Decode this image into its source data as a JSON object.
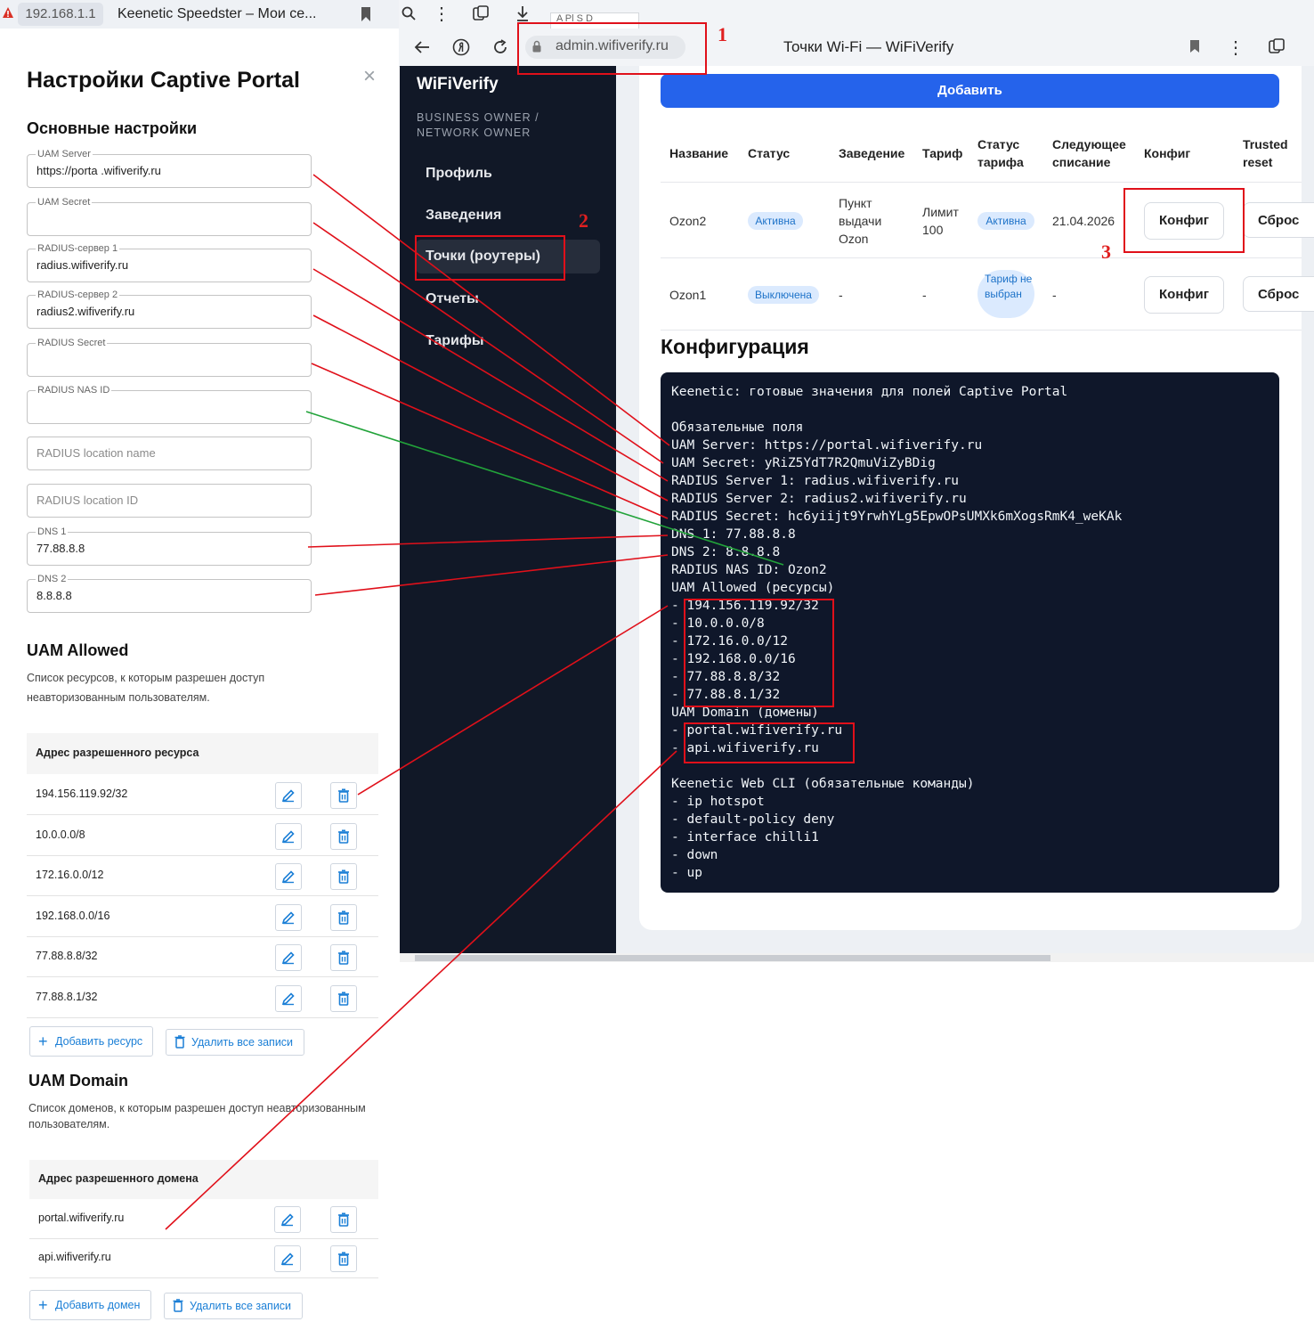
{
  "left_browser": {
    "address": "192.168.1.1",
    "tab_title": "Keenetic Speedster – Мои се..."
  },
  "right_browser": {
    "url": "admin.wifiverify.ru",
    "tab_title": "Точки Wi-Fi — WiFiVerify",
    "tab_strip_text": "A Pl S D"
  },
  "settings": {
    "title": "Настройки Captive Portal",
    "basic_heading": "Основные настройки",
    "fields": [
      {
        "label": "UAM Server",
        "value": "https://porta .wifiverify.ru",
        "placeholder": ""
      },
      {
        "label": "UAM Secret",
        "value": "",
        "placeholder": ""
      },
      {
        "label": "RADIUS-сервер 1",
        "value": "radius.wifiverify.ru",
        "placeholder": ""
      },
      {
        "label": "RADIUS-сервер 2",
        "value": "radius2.wifiverify.ru",
        "placeholder": ""
      },
      {
        "label": "RADIUS Secret",
        "value": "",
        "placeholder": ""
      },
      {
        "label": "RADIUS NAS ID",
        "value": "",
        "placeholder": ""
      },
      {
        "label": "",
        "value": "",
        "placeholder": "RADIUS location name"
      },
      {
        "label": "",
        "value": "",
        "placeholder": "RADIUS location ID"
      },
      {
        "label": "DNS 1",
        "value": "77.88.8.8",
        "placeholder": ""
      },
      {
        "label": "DNS 2",
        "value": "8.8.8.8",
        "placeholder": ""
      }
    ],
    "uam_allowed": {
      "heading": "UAM Allowed",
      "description": "Список ресурсов, к которым разрешен доступ неавторизованным пользователям.",
      "column": "Адрес разрешенного ресурса",
      "rows": [
        "194.156.119.92/32",
        "10.0.0.0/8",
        "172.16.0.0/12",
        "192.168.0.0/16",
        "77.88.8.8/32",
        "77.88.8.1/32"
      ],
      "add_label": "Добавить ресурс",
      "delete_all_label": "Удалить все записи"
    },
    "uam_domain": {
      "heading": "UAM Domain",
      "description": "Список доменов, к которым разрешен доступ неавторизованным пользователям.",
      "column": "Адрес разрешенного домена",
      "rows": [
        "portal.wifiverify.ru",
        "api.wifiverify.ru"
      ],
      "add_label": "Добавить домен",
      "delete_all_label": "Удалить все записи"
    }
  },
  "sidebar": {
    "brand": "WiFiVerify",
    "role": "BUSINESS OWNER / NETWORK OWNER",
    "items": [
      "Профиль",
      "Заведения",
      "Точки (роутеры)",
      "Отчеты",
      "Тарифы"
    ],
    "active": "Точки (роутеры)"
  },
  "points": {
    "add_label": "Добавить",
    "columns": [
      "Название",
      "Статус",
      "Заведение",
      "Тариф",
      "Статус тарифа",
      "Следующее списание",
      "Конфиг",
      "Trusted reset"
    ],
    "rows": [
      {
        "name": "Ozon2",
        "status": "Активна",
        "venue": "Пункт выдачи Ozon",
        "tariff": "Лимит 100",
        "tariff_status": "Активна",
        "next_charge": "21.04.2026",
        "config": "Конфиг",
        "reset": "Сброс"
      },
      {
        "name": "Ozon1",
        "status": "Выключена",
        "venue": "-",
        "tariff": "-",
        "tariff_status": "Тариф не выбран",
        "next_charge": "-",
        "config": "Конфиг",
        "reset": "Сброс"
      }
    ]
  },
  "config": {
    "title": "Конфигурация",
    "lines": [
      "Keenetic: готовые значения для полей Captive Portal",
      "",
      "Обязательные поля",
      "UAM Server: https://portal.wifiverify.ru",
      "UAM Secret: yRiZ5YdT7R2QmuViZyBDig",
      "RADIUS Server 1: radius.wifiverify.ru",
      "RADIUS Server 2: radius2.wifiverify.ru",
      "RADIUS Secret: hc6yiijt9YrwhYLg5EpwOPsUMXk6mXogsRmK4_weKAk",
      "DNS 1: 77.88.8.8",
      "DNS 2: 8.8.8.8",
      "RADIUS NAS ID: Ozon2",
      "UAM Allowed (ресурсы)",
      "- 194.156.119.92/32",
      "- 10.0.0.0/8",
      "- 172.16.0.0/12",
      "- 192.168.0.0/16",
      "- 77.88.8.8/32",
      "- 77.88.8.1/32",
      "UAM Domain (домены)",
      "- portal.wifiverify.ru",
      "- api.wifiverify.ru",
      "",
      "Keenetic Web CLI (обязательные команды)",
      "- ip hotspot",
      "- default-policy deny",
      "- interface chilli1",
      "- down",
      "- up"
    ]
  },
  "annotations": [
    "1",
    "2",
    "3"
  ],
  "colors": {
    "accent": "#2563eb",
    "sidebar": "#111827",
    "code_bg": "#0f172a",
    "annotation_red": "#e0101a",
    "annotation_green": "#22a33a"
  }
}
